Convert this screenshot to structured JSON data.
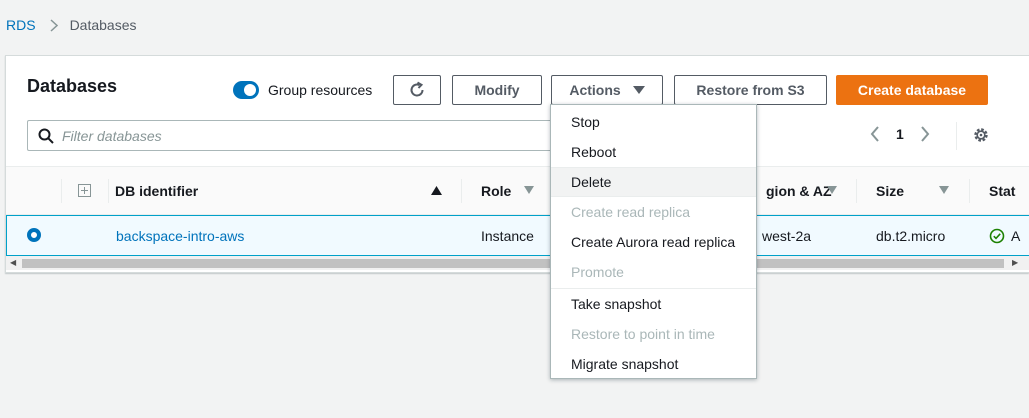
{
  "breadcrumb": {
    "root": "RDS",
    "current": "Databases"
  },
  "panel": {
    "title": "Databases",
    "group_resources_label": "Group resources",
    "group_resources_on": true
  },
  "toolbar": {
    "modify_label": "Modify",
    "actions_label": "Actions",
    "restore_label": "Restore from S3",
    "create_label": "Create database"
  },
  "search": {
    "placeholder": "Filter databases"
  },
  "pagination": {
    "current_page": "1"
  },
  "table": {
    "columns": [
      "DB identifier",
      "Role",
      "Region & AZ",
      "Size",
      "Status"
    ],
    "visible_header_fragments": {
      "region": "gion & AZ",
      "status": "Stat"
    },
    "rows": [
      {
        "identifier": "backspace-intro-aws",
        "role": "Instance",
        "region_fragment": "west-2a",
        "size": "db.t2.micro",
        "status_icon": "check-circle-icon",
        "status_fragment": "A",
        "selected": true
      }
    ]
  },
  "actions_menu": {
    "items": [
      {
        "label": "Stop",
        "enabled": true
      },
      {
        "label": "Reboot",
        "enabled": true
      },
      {
        "label": "Delete",
        "enabled": true,
        "hovered": true
      },
      {
        "label": "Create read replica",
        "enabled": false
      },
      {
        "label": "Create Aurora read replica",
        "enabled": true
      },
      {
        "label": "Promote",
        "enabled": false
      },
      {
        "label": "Take snapshot",
        "enabled": true
      },
      {
        "label": "Restore to point in time",
        "enabled": false
      },
      {
        "label": "Migrate snapshot",
        "enabled": true
      }
    ]
  },
  "colors": {
    "link": "#0073bb",
    "primary_button": "#ec7211",
    "selected_row_bg": "#f1faff",
    "selected_row_border": "#00a1c9",
    "status_ok": "#1d8102",
    "disabled_text": "#aab7b8"
  }
}
